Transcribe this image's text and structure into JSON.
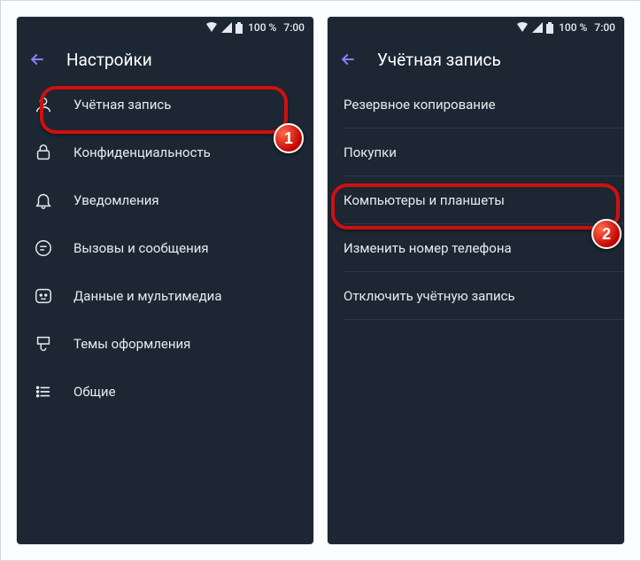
{
  "statusbar": {
    "battery": "100 %",
    "time": "7:00"
  },
  "left": {
    "title": "Настройки",
    "items": [
      {
        "label": "Учётная запись"
      },
      {
        "label": "Конфиденциальность"
      },
      {
        "label": "Уведомления"
      },
      {
        "label": "Вызовы и сообщения"
      },
      {
        "label": "Данные и мультимедиа"
      },
      {
        "label": "Темы оформления"
      },
      {
        "label": "Общие"
      }
    ]
  },
  "right": {
    "title": "Учётная запись",
    "items": [
      {
        "label": "Резервное копирование"
      },
      {
        "label": "Покупки"
      },
      {
        "label": "Компьютеры и планшеты"
      },
      {
        "label": "Изменить номер телефона"
      },
      {
        "label": "Отключить учётную запись"
      }
    ]
  },
  "steps": {
    "one": "1",
    "two": "2"
  }
}
